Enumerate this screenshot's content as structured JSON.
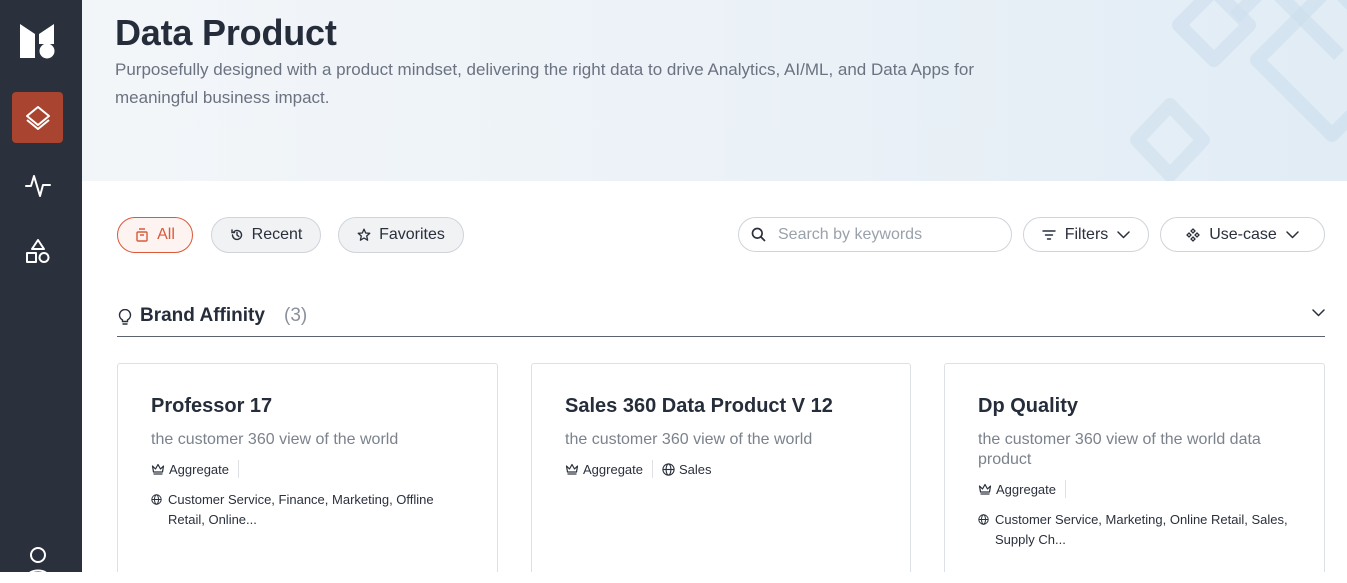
{
  "sidebar": {
    "logo": "app-logo",
    "items": [
      {
        "icon": "layers-icon",
        "active": true
      },
      {
        "icon": "activity-icon",
        "active": false
      },
      {
        "icon": "shapes-icon",
        "active": false
      }
    ],
    "user_icon": "user-icon"
  },
  "hero": {
    "title": "Data Product",
    "subtitle": "Purposefully designed with a product mindset, delivering the right data to drive Analytics, AI/ML, and Data Apps for meaningful business impact."
  },
  "toolbar": {
    "tabs": [
      {
        "label": "All",
        "icon": "box-icon",
        "active": true
      },
      {
        "label": "Recent",
        "icon": "history-icon",
        "active": false
      },
      {
        "label": "Favorites",
        "icon": "star-icon",
        "active": false
      }
    ],
    "search_placeholder": "Search by keywords",
    "filters_label": "Filters",
    "usecase_label": "Use-case"
  },
  "section": {
    "title": "Brand Affinity",
    "count": "(3)"
  },
  "cards": [
    {
      "title": "Professor 17",
      "description": "the customer 360 view of the world",
      "tags": [
        "Aggregate"
      ],
      "domains": "Customer Service, Finance, Marketing, Offline Retail, Online..."
    },
    {
      "title": "Sales 360 Data Product V 12",
      "description": "the customer 360 view of the world",
      "tags": [
        "Aggregate",
        "Sales"
      ],
      "domains": ""
    },
    {
      "title": "Dp Quality",
      "description": "the customer 360 view of the world data product",
      "tags": [
        "Aggregate"
      ],
      "domains": "Customer Service, Marketing, Online Retail, Sales, Supply Ch..."
    }
  ],
  "colors": {
    "sidebar_bg": "#2a303c",
    "active_accent": "#a8442f",
    "chip_active": "#d9593a"
  }
}
